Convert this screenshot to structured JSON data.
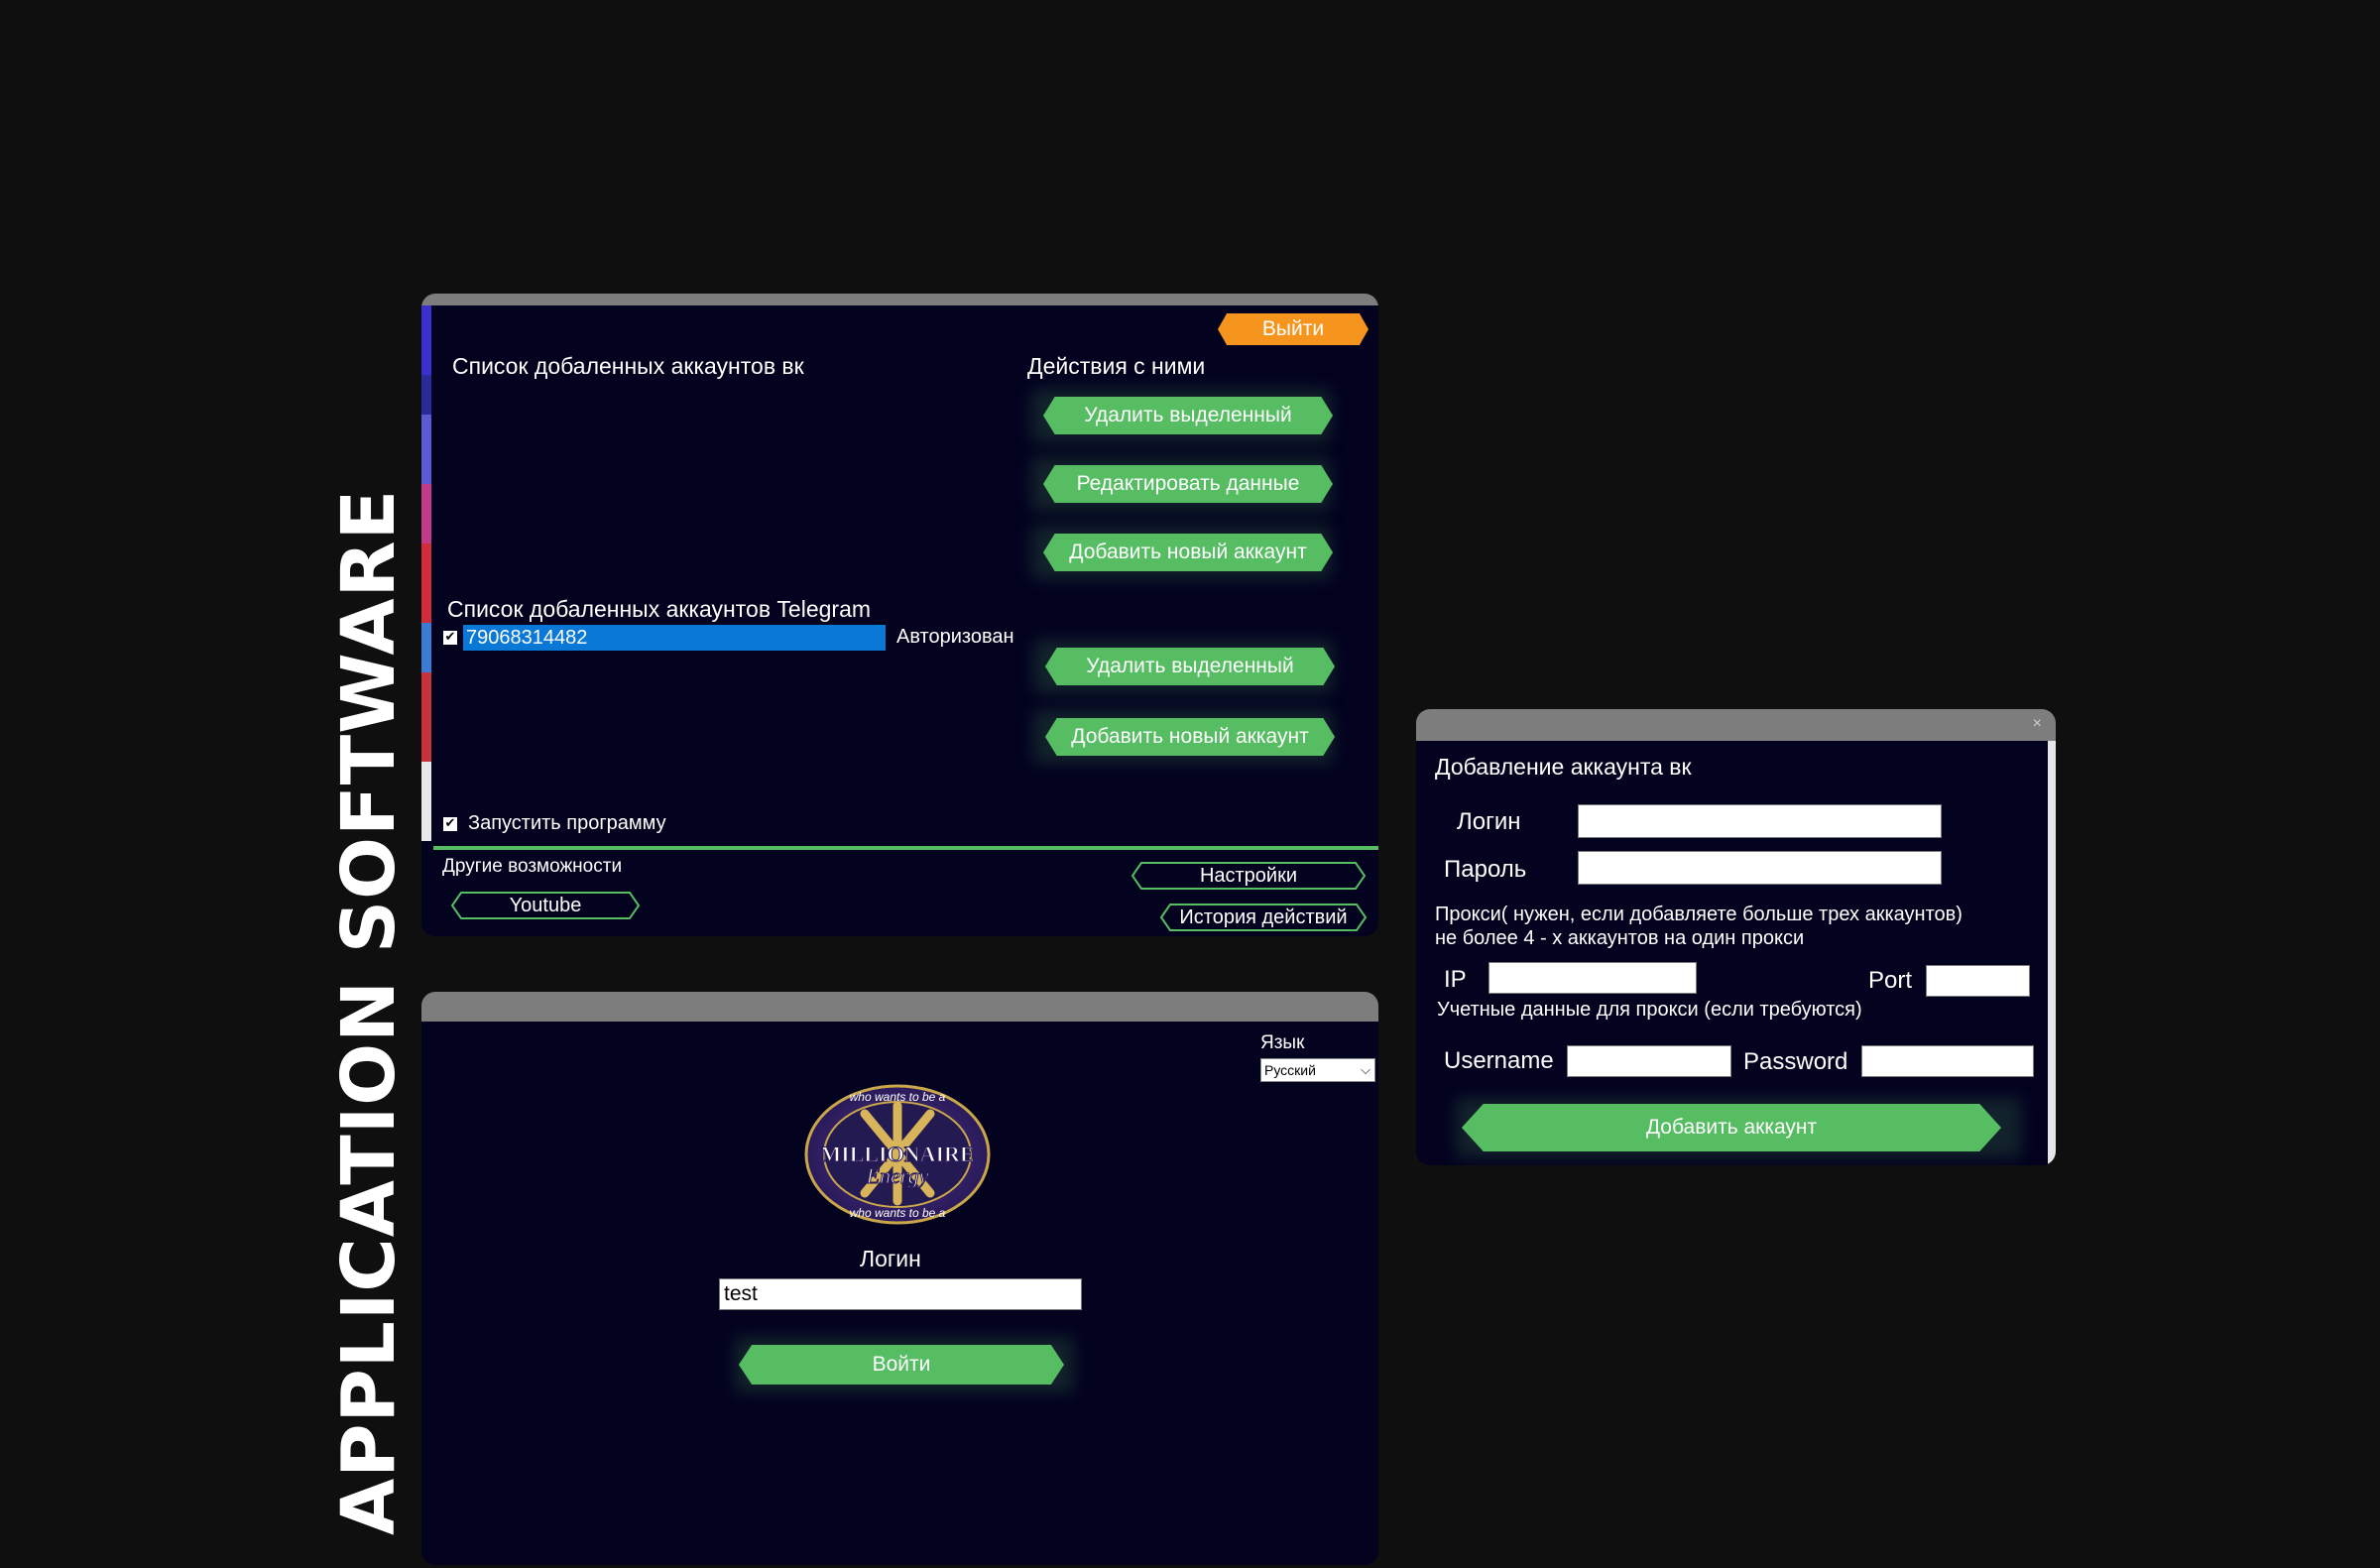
{
  "page_title": "APPLICATION SOFTWARE",
  "main_window": {
    "exit_label": "Выйти",
    "vk_list_title": "Список добаленных аккаунтов вк",
    "actions_title": "Действия с ними",
    "vk_delete_label": "Удалить выделенный",
    "vk_edit_label": "Редактировать данные",
    "vk_add_label": "Добавить новый аккаунт",
    "tg_list_title": "Список добаленных аккаунтов Telegram",
    "tg_accounts": [
      {
        "number": "79068314482",
        "status": "Авторизован",
        "checked": true
      }
    ],
    "tg_delete_label": "Удалить выделенный",
    "tg_add_label": "Добавить новый аккаунт",
    "run_program_label": "Запустить программу",
    "other_features_label": "Другие возможности",
    "youtube_label": "Youtube",
    "settings_label": "Настройки",
    "history_label": "История действий",
    "colors": {
      "accent_green": "#56bd63",
      "exit_orange": "#f5951e",
      "selection_blue": "#0a78d7",
      "background": "#03021f"
    }
  },
  "login_window": {
    "language_label": "Язык",
    "language_selected": "Русский",
    "logo": {
      "text_top": "who wants to be a",
      "text_main": "MILLIONAIRE",
      "text_sub": "Energy",
      "text_bottom": "who wants to be a"
    },
    "login_label": "Логин",
    "login_value": "test",
    "enter_label": "Войти"
  },
  "add_vk_window": {
    "title": "Добавление аккаунта вк",
    "close_icon": "×",
    "login_label": "Логин",
    "password_label": "Пароль",
    "proxy_note_line1": "Прокси( нужен, если добавляете больше трех аккаунтов)",
    "proxy_note_line2": "не более 4 - х аккаунтов на один прокси",
    "ip_label": "IP",
    "port_label": "Port",
    "credentials_note": "Учетные данные для прокси (если требуются)",
    "username_label": "Username",
    "password_en_label": "Password",
    "add_account_label": "Добавить аккаунт"
  }
}
